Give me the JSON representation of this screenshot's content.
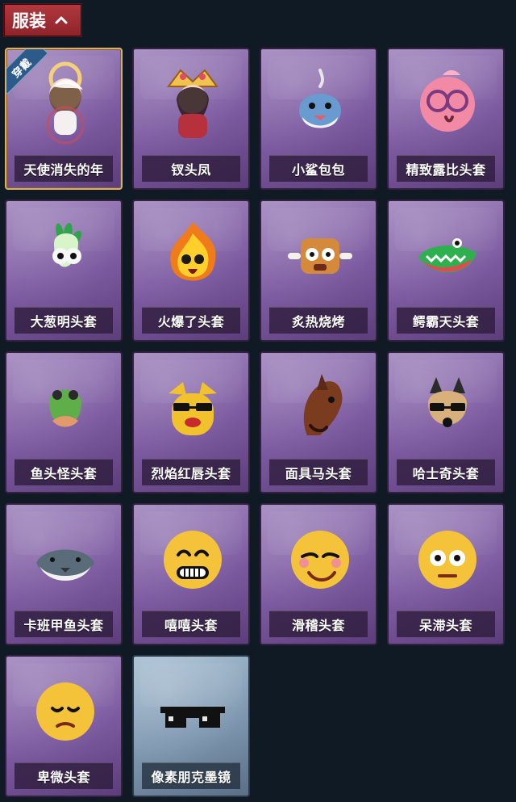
{
  "header": {
    "tab_label": "服装",
    "tab_icon": "chevron-up-icon"
  },
  "grid": {
    "items": [
      {
        "name": "天使消失的年",
        "badge": "穿戴",
        "selected": true,
        "icon": "angel-doll-icon"
      },
      {
        "name": "钗头凤",
        "icon": "phoenix-crown-icon"
      },
      {
        "name": "小鲨包包",
        "icon": "shark-bag-icon"
      },
      {
        "name": "精致露比头套",
        "icon": "pink-beaver-head-icon"
      },
      {
        "name": "大葱明头套",
        "icon": "green-onion-head-icon"
      },
      {
        "name": "火爆了头套",
        "icon": "fire-head-icon"
      },
      {
        "name": "炙热烧烤",
        "icon": "bbq-meat-head-icon"
      },
      {
        "name": "鳄霸天头套",
        "icon": "crocodile-head-icon"
      },
      {
        "name": "鱼头怪头套",
        "icon": "fish-head-icon"
      },
      {
        "name": "烈焰红唇头套",
        "icon": "yellow-mascot-head-icon"
      },
      {
        "name": "面具马头套",
        "icon": "horse-head-icon"
      },
      {
        "name": "哈士奇头套",
        "icon": "husky-head-icon"
      },
      {
        "name": "卡班甲鱼头套",
        "icon": "carp-head-icon"
      },
      {
        "name": "嘻嘻头套",
        "icon": "grinning-emoji-head-icon"
      },
      {
        "name": "滑稽头套",
        "icon": "smug-emoji-head-icon"
      },
      {
        "name": "呆滞头套",
        "icon": "dazed-emoji-head-icon"
      },
      {
        "name": "卑微头套",
        "icon": "humble-emoji-head-icon"
      },
      {
        "name": "像素朋克墨镜",
        "icon": "pixel-sunglasses-icon",
        "special": true
      }
    ]
  }
}
